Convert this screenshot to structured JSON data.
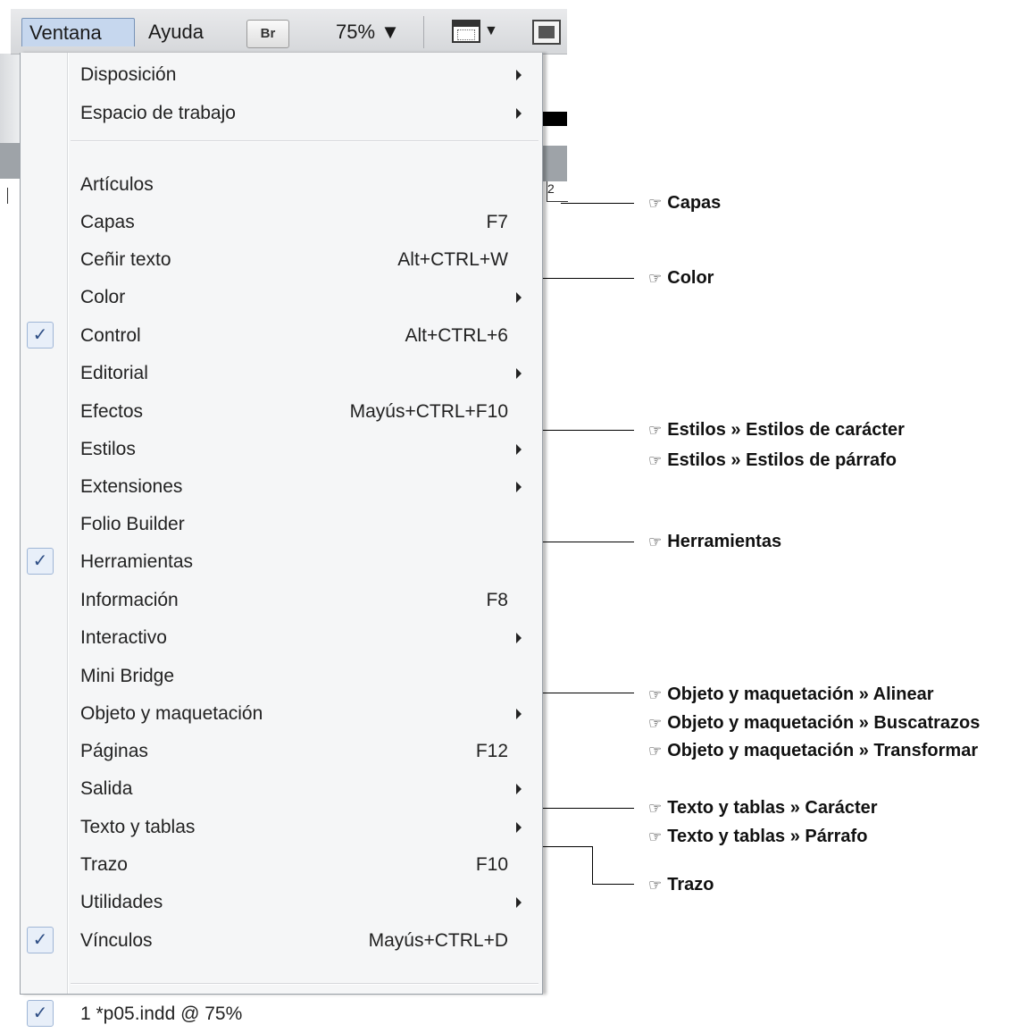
{
  "menubar": {
    "ventana": "Ventana",
    "ayuda": "Ayuda",
    "br": "Br",
    "zoom": "75% ▼",
    "view_arrow": "▼"
  },
  "menu": {
    "items": [
      {
        "label": "Disposición",
        "shortcut": "",
        "submenu": true,
        "checked": false
      },
      {
        "label": "Espacio de trabajo",
        "shortcut": "",
        "submenu": true,
        "checked": false
      },
      {
        "label": "Artículos",
        "shortcut": "",
        "submenu": false,
        "checked": false
      },
      {
        "label": "Capas",
        "shortcut": "F7",
        "submenu": false,
        "checked": false
      },
      {
        "label": "Ceñir texto",
        "shortcut": "Alt+CTRL+W",
        "submenu": false,
        "checked": false
      },
      {
        "label": "Color",
        "shortcut": "",
        "submenu": true,
        "checked": false
      },
      {
        "label": "Control",
        "shortcut": "Alt+CTRL+6",
        "submenu": false,
        "checked": true
      },
      {
        "label": "Editorial",
        "shortcut": "",
        "submenu": true,
        "checked": false
      },
      {
        "label": "Efectos",
        "shortcut": "Mayús+CTRL+F10",
        "submenu": false,
        "checked": false
      },
      {
        "label": "Estilos",
        "shortcut": "",
        "submenu": true,
        "checked": false
      },
      {
        "label": "Extensiones",
        "shortcut": "",
        "submenu": true,
        "checked": false
      },
      {
        "label": "Folio Builder",
        "shortcut": "",
        "submenu": false,
        "checked": false
      },
      {
        "label": "Herramientas",
        "shortcut": "",
        "submenu": false,
        "checked": true
      },
      {
        "label": "Información",
        "shortcut": "F8",
        "submenu": false,
        "checked": false
      },
      {
        "label": "Interactivo",
        "shortcut": "",
        "submenu": true,
        "checked": false
      },
      {
        "label": "Mini Bridge",
        "shortcut": "",
        "submenu": false,
        "checked": false
      },
      {
        "label": "Objeto y maquetación",
        "shortcut": "",
        "submenu": true,
        "checked": false
      },
      {
        "label": "Páginas",
        "shortcut": "F12",
        "submenu": false,
        "checked": false
      },
      {
        "label": "Salida",
        "shortcut": "",
        "submenu": true,
        "checked": false
      },
      {
        "label": "Texto y tablas",
        "shortcut": "",
        "submenu": true,
        "checked": false
      },
      {
        "label": "Trazo",
        "shortcut": "F10",
        "submenu": false,
        "checked": false
      },
      {
        "label": "Utilidades",
        "shortcut": "",
        "submenu": true,
        "checked": false
      },
      {
        "label": "Vínculos",
        "shortcut": "Mayús+CTRL+D",
        "submenu": false,
        "checked": true
      },
      {
        "label": "1 *p05.indd @ 75%",
        "shortcut": "",
        "submenu": false,
        "checked": true
      }
    ],
    "check_glyph": "✓",
    "ruler_digit": "2"
  },
  "callouts": {
    "hand_glyph": "☞",
    "capas": "Capas",
    "color": "Color",
    "estilos_caracter": "Estilos » Estilos de carácter",
    "estilos_parrafo": "Estilos » Estilos de párrafo",
    "herramientas": "Herramientas",
    "obj_alinear": "Objeto y maquetación » Alinear",
    "obj_buscatrazos": "Objeto y maquetación » Buscatrazos",
    "obj_transformar": "Objeto y maquetación » Transformar",
    "texto_caracter": "Texto y tablas » Carácter",
    "texto_parrafo": "Texto y tablas » Párrafo",
    "trazo": "Trazo"
  },
  "colors": {
    "menu_bg": "#f5f6f7",
    "ventana_highlight": "#c6d7ee",
    "check_fg": "#2f4f86"
  }
}
